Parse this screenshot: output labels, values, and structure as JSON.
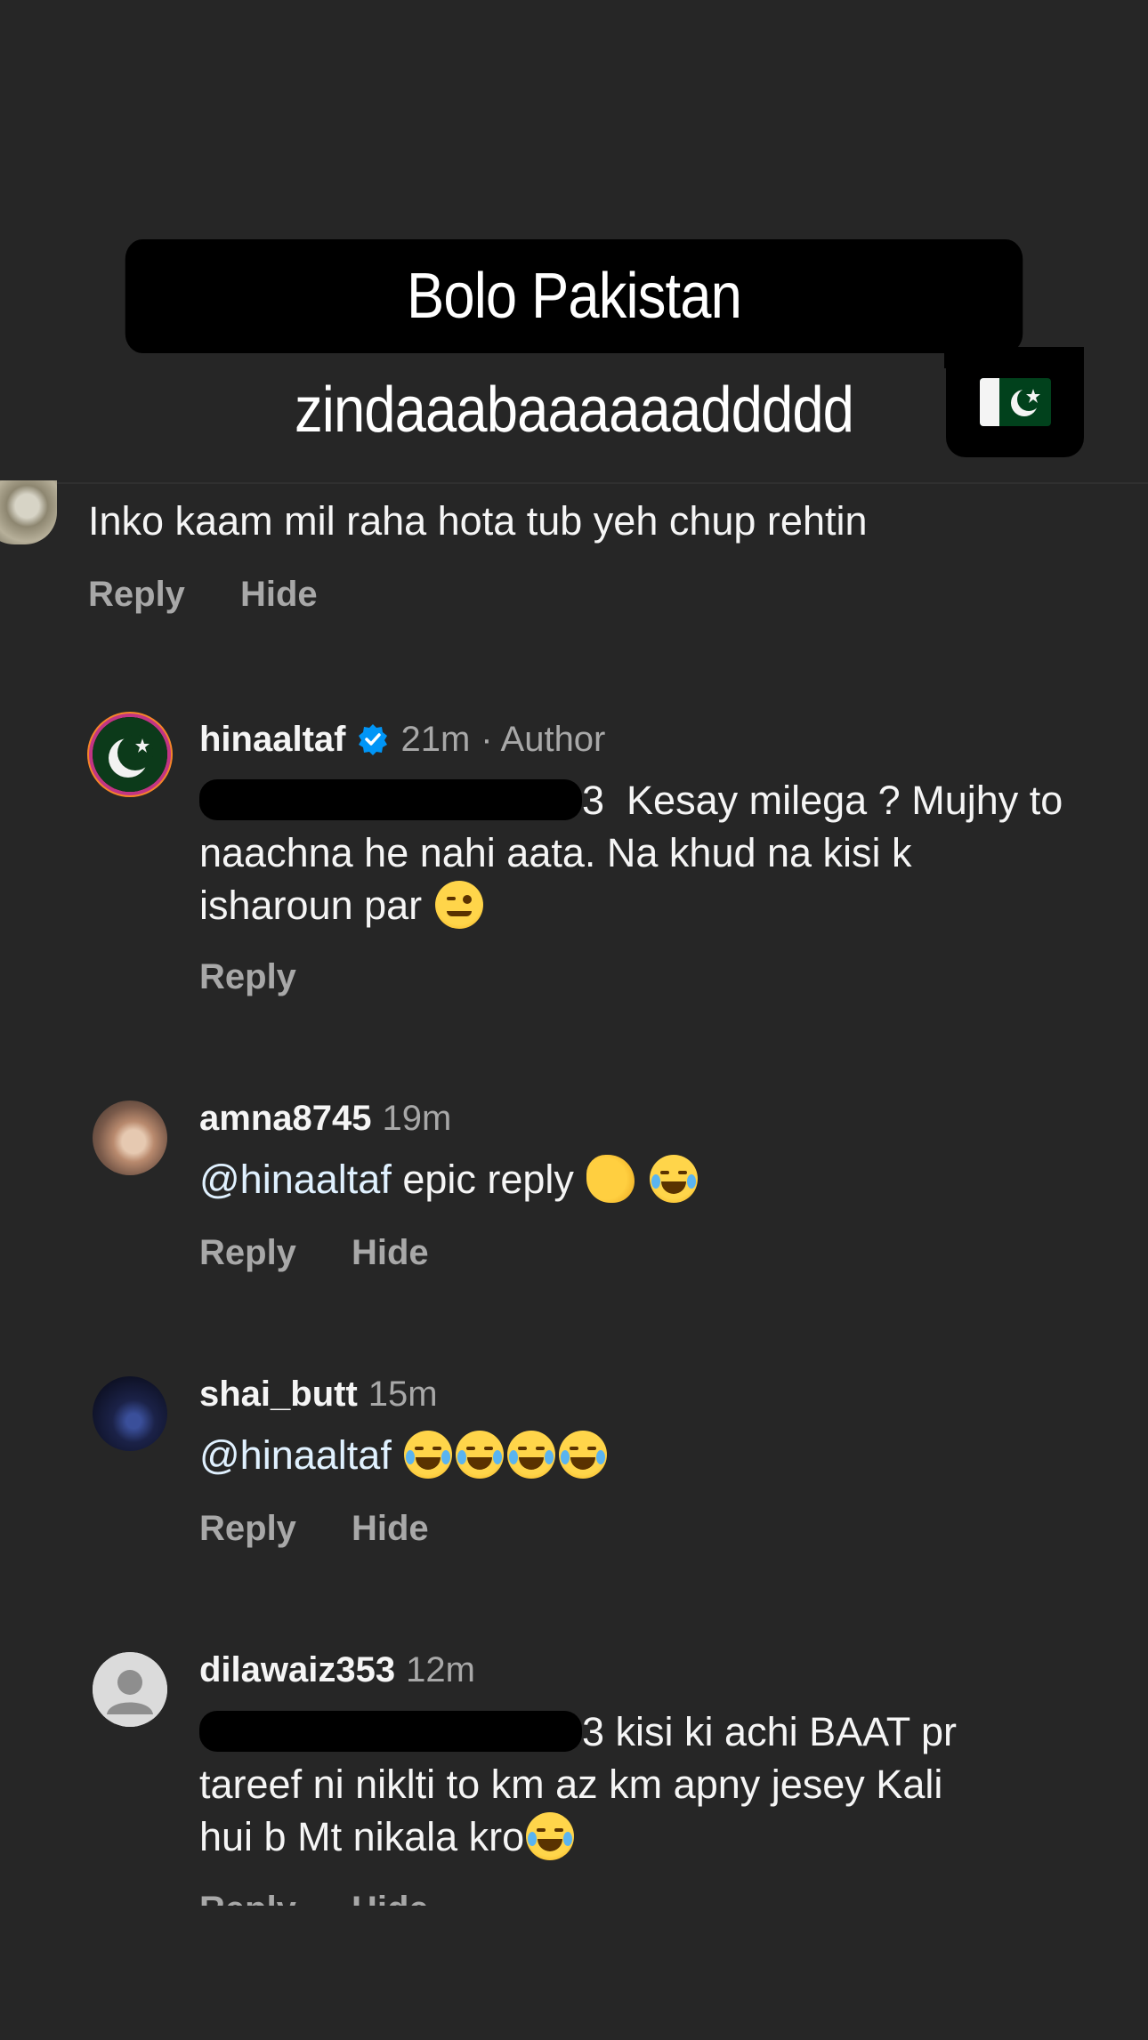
{
  "story": {
    "caption_line1": "Bolo Pakistan zindaaabaaaaaaddddd",
    "caption_flag_emoji": "pakistan-flag"
  },
  "parent_comment": {
    "text": "Inko kaam mil raha hota tub yeh chup rehtin",
    "reply_label": "Reply",
    "hide_label": "Hide"
  },
  "replies": [
    {
      "username": "hinaaltaf",
      "verified": true,
      "time": "21m",
      "author_badge": "· Author",
      "mention_tail": "3",
      "text_line1": "Kesay milega ? Mujhy to",
      "text_line2": "naachna he nahi aata. Na khud na kisi k",
      "text_line3": "isharoun par",
      "reply_label": "Reply"
    },
    {
      "username": "amna8745",
      "time": "19m",
      "mention": "@hinaaltaf",
      "text": "epic  reply",
      "reply_label": "Reply",
      "hide_label": "Hide"
    },
    {
      "username": "shai_butt",
      "time": "15m",
      "mention": "@hinaaltaf",
      "reply_label": "Reply",
      "hide_label": "Hide"
    },
    {
      "username": "dilawaiz353",
      "time": "12m",
      "mention_tail": "3",
      "text_line1": "kisi ki achi BAAT pr",
      "text_line2": "tareef ni niklti to km az km apny jesey Kali",
      "text_line3": "hui b Mt nikala kro",
      "reply_label": "Reply",
      "hide_label": "Hide"
    }
  ],
  "colors": {
    "background": "#262626",
    "mention": "#e0f1ff",
    "secondary_text": "#a8a8a8",
    "verified_blue": "#0095f6"
  }
}
